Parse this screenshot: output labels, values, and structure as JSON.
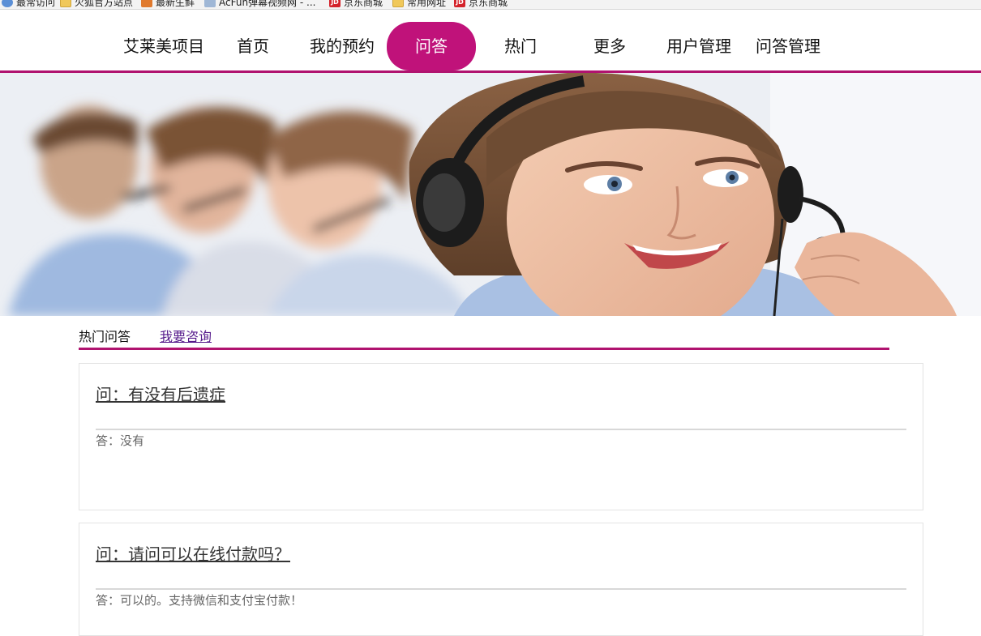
{
  "bookmarks": [
    {
      "label": "最常访问",
      "icon": "globe-icon"
    },
    {
      "label": "火狐官方站点",
      "icon": "folder-icon"
    },
    {
      "label": "最新生鲜",
      "icon": "firefox-icon"
    },
    {
      "label": "AcFun弹幕视频网 - ...",
      "icon": "image-icon"
    },
    {
      "label": "京东商城",
      "icon": "jd-icon"
    },
    {
      "label": "常用网址",
      "icon": "folder-icon"
    },
    {
      "label": "京东商城",
      "icon": "jd-icon"
    }
  ],
  "nav": {
    "brand": "艾莱美项目",
    "items": [
      "首页",
      "我的预约",
      "问答",
      "热门",
      "更多",
      "用户管理",
      "问答管理"
    ],
    "active": "问答",
    "accent": "#c0127a"
  },
  "tabs": {
    "hot": "热门问答",
    "ask": "我要咨询"
  },
  "qa": [
    {
      "question": "问：有没有后遗症",
      "answer": "答：没有"
    },
    {
      "question": "问：请问可以在线付款吗？",
      "answer": "答：可以的。支持微信和支付宝付款！"
    }
  ]
}
